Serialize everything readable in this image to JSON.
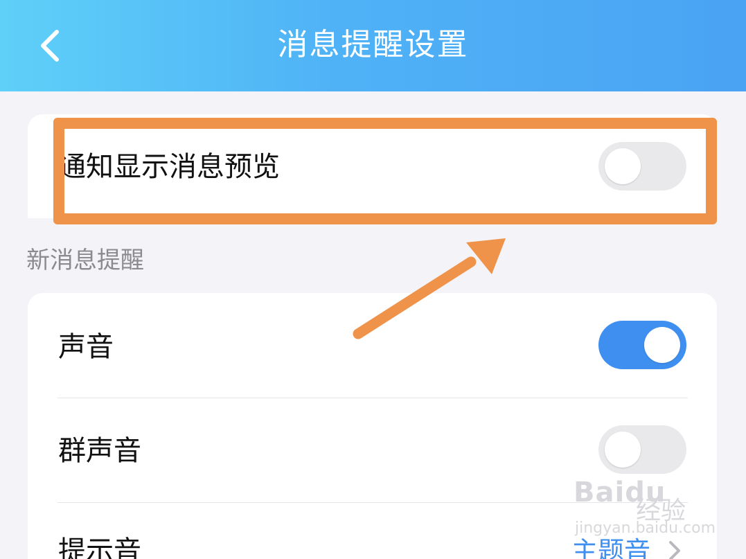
{
  "header": {
    "title": "消息提醒设置",
    "back_icon": "chevron-left-icon"
  },
  "preview_card": {
    "label": "通知显示消息预览",
    "toggle_on": false
  },
  "new_message": {
    "section_label": "新消息提醒",
    "rows": [
      {
        "label": "声音",
        "toggle_on": true
      },
      {
        "label": "群声音",
        "toggle_on": false
      },
      {
        "label": "提示音",
        "value": "主题音"
      }
    ]
  },
  "colors": {
    "header_gradient_start": "#5fd0f8",
    "header_gradient_end": "#4aa3f3",
    "toggle_on": "#3f8ff0",
    "toggle_off": "#e9e9eb",
    "annotation": "#f0934a",
    "background": "#f4f4f8"
  },
  "watermark": {
    "logo": "Baidu",
    "cn": "经验",
    "url": "jingyan.baidu.com"
  }
}
